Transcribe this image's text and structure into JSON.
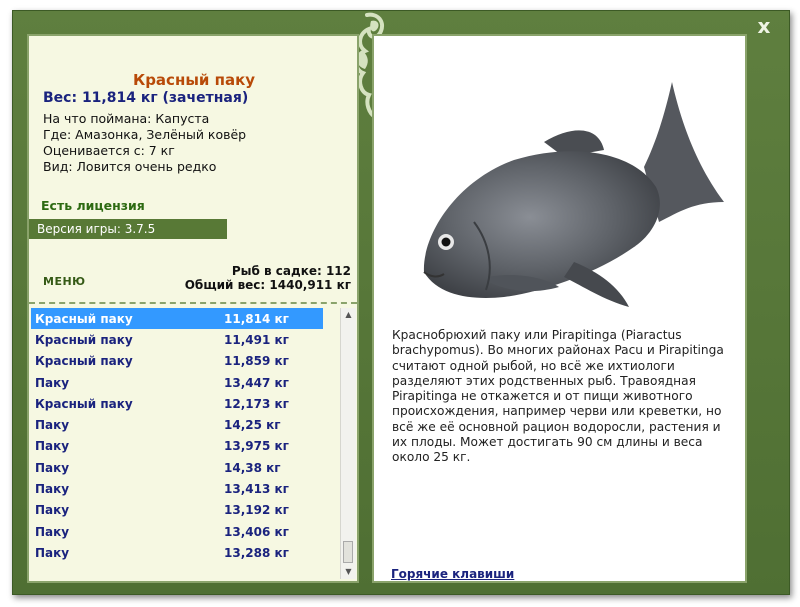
{
  "window": {
    "close_glyph": "x"
  },
  "fish": {
    "title": "Красный паку",
    "weight_line": "Вес: 11,814 кг (зачетная)",
    "details": [
      "На что поймана: Капуста",
      "Где: Амазонка, Зелёный ковёр",
      "Оценивается с: 7 кг",
      "Вид: Ловится очень редко"
    ]
  },
  "license": "Есть лицензия",
  "version": "Версия игры: 3.7.5",
  "menu_label": "МЕНЮ",
  "stats": {
    "count_line": "Рыб в садке: 112",
    "total_line": "Общий вес: 1440,911 кг"
  },
  "catch_list": [
    {
      "name": "Красный паку",
      "weight": "11,814 кг",
      "selected": true
    },
    {
      "name": "Красный паку",
      "weight": "11,491 кг"
    },
    {
      "name": "Красный паку",
      "weight": "11,859 кг"
    },
    {
      "name": "Паку",
      "weight": "13,447 кг"
    },
    {
      "name": "Красный паку",
      "weight": "12,173 кг"
    },
    {
      "name": "Паку",
      "weight": "14,25 кг"
    },
    {
      "name": "Паку",
      "weight": "13,975 кг"
    },
    {
      "name": "Паку",
      "weight": "14,38 кг"
    },
    {
      "name": "Паку",
      "weight": "13,413 кг"
    },
    {
      "name": "Паку",
      "weight": "13,192 кг"
    },
    {
      "name": "Паку",
      "weight": "13,406 кг"
    },
    {
      "name": "Паку",
      "weight": "13,288 кг"
    }
  ],
  "description": "Краснобрюхий паку или Pirapitinga (Piaractus brachypomus). Во многих районах Pacu и Pirapitinga считают одной рыбой, но всё же ихтиологи разделяют этих родственных рыб. Травоядная Pirapitinga не откажется и от пищи животного происхождения, например черви или креветки, но всё же её основной рацион водоросли, растения и их плоды. Может достигать 90 см длины и веса около 25 кг.",
  "hotkeys_label": "Горячие клавиши",
  "colors": {
    "frame": "#5f7f3f",
    "title": "#b84a08",
    "weight": "#1a237e",
    "selection": "#3399ff"
  }
}
